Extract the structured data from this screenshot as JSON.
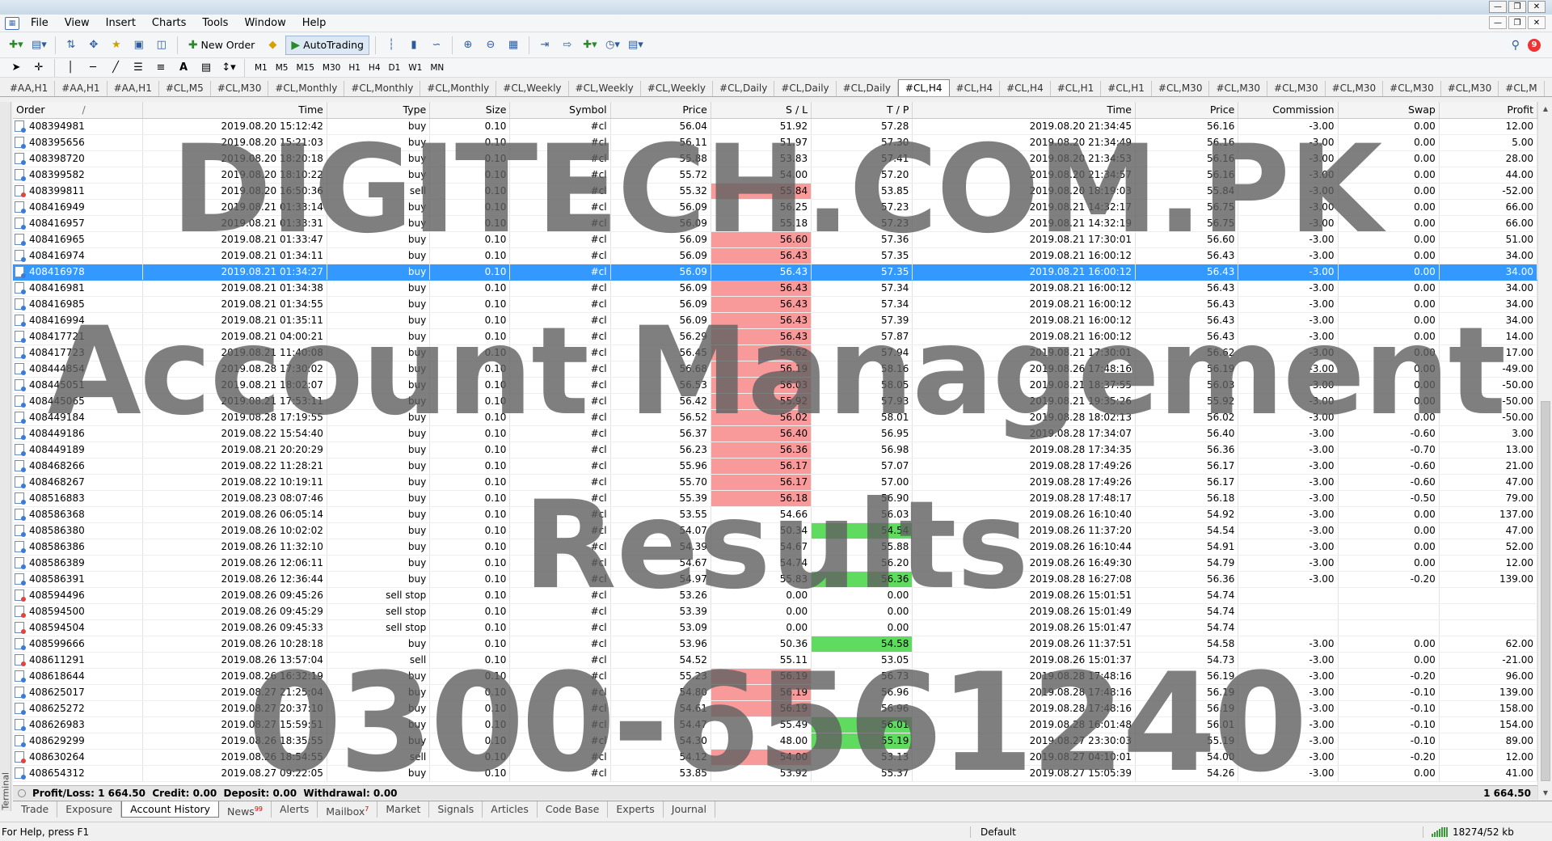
{
  "menu": [
    "File",
    "View",
    "Insert",
    "Charts",
    "Tools",
    "Window",
    "Help"
  ],
  "toolbar": {
    "new_order_label": "New Order",
    "autotrading_label": "AutoTrading",
    "timeframes": [
      "M1",
      "M5",
      "M15",
      "M30",
      "H1",
      "H4",
      "D1",
      "W1",
      "MN"
    ],
    "notification_count": "9"
  },
  "chart_tabs": [
    "#AA,H1",
    "#AA,H1",
    "#AA,H1",
    "#CL,M5",
    "#CL,M30",
    "#CL,Monthly",
    "#CL,Monthly",
    "#CL,Monthly",
    "#CL,Weekly",
    "#CL,Weekly",
    "#CL,Weekly",
    "#CL,Daily",
    "#CL,Daily",
    "#CL,Daily",
    "#CL,H4",
    "#CL,H4",
    "#CL,H4",
    "#CL,H1",
    "#CL,H1",
    "#CL,M30",
    "#CL,M30",
    "#CL,M30",
    "#CL,M30",
    "#CL,M30",
    "#CL,M30",
    "#CL,M"
  ],
  "active_chart_tab": "#CL,H4",
  "table": {
    "columns": [
      "Order",
      "Time",
      "Type",
      "Size",
      "Symbol",
      "Price",
      "S / L",
      "T / P",
      "Time",
      "Price",
      "Commission",
      "Swap",
      "Profit"
    ],
    "sort_indicator": "/",
    "rows": [
      {
        "order": "408394981",
        "t1": "2019.08.20 15:12:42",
        "type": "buy",
        "size": "0.10",
        "sym": "#cl",
        "price": "56.04",
        "sl": "51.92",
        "tp": "57.28",
        "t2": "2019.08.20 21:34:45",
        "p2": "56.16",
        "comm": "-3.00",
        "swap": "0.00",
        "profit": "12.00"
      },
      {
        "order": "408395656",
        "t1": "2019.08.20 15:21:03",
        "type": "buy",
        "size": "0.10",
        "sym": "#cl",
        "price": "56.11",
        "sl": "51.97",
        "tp": "57.30",
        "t2": "2019.08.20 21:34:49",
        "p2": "56.16",
        "comm": "-3.00",
        "swap": "0.00",
        "profit": "5.00"
      },
      {
        "order": "408398720",
        "t1": "2019.08.20 18:20:18",
        "type": "buy",
        "size": "0.10",
        "sym": "#cl",
        "price": "55.88",
        "sl": "53.83",
        "tp": "57.41",
        "t2": "2019.08.20 21:34:53",
        "p2": "56.16",
        "comm": "-3.00",
        "swap": "0.00",
        "profit": "28.00"
      },
      {
        "order": "408399582",
        "t1": "2019.08.20 18:10:22",
        "type": "buy",
        "size": "0.10",
        "sym": "#cl",
        "price": "55.72",
        "sl": "54.00",
        "tp": "57.20",
        "t2": "2019.08.20 21:34:57",
        "p2": "56.16",
        "comm": "-3.00",
        "swap": "0.00",
        "profit": "44.00"
      },
      {
        "order": "408399811",
        "t1": "2019.08.20 16:50:36",
        "type": "sell",
        "size": "0.10",
        "sym": "#cl",
        "price": "55.32",
        "sl": "55.84",
        "tp": "53.85",
        "t2": "2019.08.20 18:19:03",
        "p2": "55.84",
        "comm": "-3.00",
        "swap": "0.00",
        "profit": "-52.00",
        "slc": "red"
      },
      {
        "order": "408416949",
        "t1": "2019.08.21 01:33:14",
        "type": "buy",
        "size": "0.10",
        "sym": "#cl",
        "price": "56.09",
        "sl": "56.25",
        "tp": "57.23",
        "t2": "2019.08.21 14:32:17",
        "p2": "56.75",
        "comm": "-3.00",
        "swap": "0.00",
        "profit": "66.00"
      },
      {
        "order": "408416957",
        "t1": "2019.08.21 01:33:31",
        "type": "buy",
        "size": "0.10",
        "sym": "#cl",
        "price": "56.09",
        "sl": "55.18",
        "tp": "57.23",
        "t2": "2019.08.21 14:32:19",
        "p2": "56.75",
        "comm": "-3.00",
        "swap": "0.00",
        "profit": "66.00"
      },
      {
        "order": "408416965",
        "t1": "2019.08.21 01:33:47",
        "type": "buy",
        "size": "0.10",
        "sym": "#cl",
        "price": "56.09",
        "sl": "56.60",
        "tp": "57.36",
        "t2": "2019.08.21 17:30:01",
        "p2": "56.60",
        "comm": "-3.00",
        "swap": "0.00",
        "profit": "51.00",
        "slc": "red"
      },
      {
        "order": "408416974",
        "t1": "2019.08.21 01:34:11",
        "type": "buy",
        "size": "0.10",
        "sym": "#cl",
        "price": "56.09",
        "sl": "56.43",
        "tp": "57.35",
        "t2": "2019.08.21 16:00:12",
        "p2": "56.43",
        "comm": "-3.00",
        "swap": "0.00",
        "profit": "34.00",
        "slc": "red"
      },
      {
        "order": "408416978",
        "t1": "2019.08.21 01:34:27",
        "type": "buy",
        "size": "0.10",
        "sym": "#cl",
        "price": "56.09",
        "sl": "56.43",
        "tp": "57.35",
        "t2": "2019.08.21 16:00:12",
        "p2": "56.43",
        "comm": "-3.00",
        "swap": "0.00",
        "profit": "34.00",
        "selected": true
      },
      {
        "order": "408416981",
        "t1": "2019.08.21 01:34:38",
        "type": "buy",
        "size": "0.10",
        "sym": "#cl",
        "price": "56.09",
        "sl": "56.43",
        "tp": "57.34",
        "t2": "2019.08.21 16:00:12",
        "p2": "56.43",
        "comm": "-3.00",
        "swap": "0.00",
        "profit": "34.00",
        "slc": "red"
      },
      {
        "order": "408416985",
        "t1": "2019.08.21 01:34:55",
        "type": "buy",
        "size": "0.10",
        "sym": "#cl",
        "price": "56.09",
        "sl": "56.43",
        "tp": "57.34",
        "t2": "2019.08.21 16:00:12",
        "p2": "56.43",
        "comm": "-3.00",
        "swap": "0.00",
        "profit": "34.00",
        "slc": "red"
      },
      {
        "order": "408416994",
        "t1": "2019.08.21 01:35:11",
        "type": "buy",
        "size": "0.10",
        "sym": "#cl",
        "price": "56.09",
        "sl": "56.43",
        "tp": "57.39",
        "t2": "2019.08.21 16:00:12",
        "p2": "56.43",
        "comm": "-3.00",
        "swap": "0.00",
        "profit": "34.00",
        "slc": "red"
      },
      {
        "order": "408417721",
        "t1": "2019.08.21 04:00:21",
        "type": "buy",
        "size": "0.10",
        "sym": "#cl",
        "price": "56.29",
        "sl": "56.43",
        "tp": "57.87",
        "t2": "2019.08.21 16:00:12",
        "p2": "56.43",
        "comm": "-3.00",
        "swap": "0.00",
        "profit": "14.00",
        "slc": "red"
      },
      {
        "order": "408417723",
        "t1": "2019.08.21 11:40:08",
        "type": "buy",
        "size": "0.10",
        "sym": "#cl",
        "price": "56.45",
        "sl": "56.62",
        "tp": "57.94",
        "t2": "2019.08.21 17:30:01",
        "p2": "56.62",
        "comm": "-3.00",
        "swap": "0.00",
        "profit": "17.00",
        "slc": "red"
      },
      {
        "order": "408444854",
        "t1": "2019.08.28 17:30:02",
        "type": "buy",
        "size": "0.10",
        "sym": "#cl",
        "price": "56.68",
        "sl": "56.19",
        "tp": "58.16",
        "t2": "2019.08.26 17:48:16",
        "p2": "56.19",
        "comm": "-3.00",
        "swap": "0.00",
        "profit": "-49.00",
        "slc": "red"
      },
      {
        "order": "408445051",
        "t1": "2019.08.21 18:02:07",
        "type": "buy",
        "size": "0.10",
        "sym": "#cl",
        "price": "56.53",
        "sl": "56.03",
        "tp": "58.05",
        "t2": "2019.08.21 18:37:55",
        "p2": "56.03",
        "comm": "-3.00",
        "swap": "0.00",
        "profit": "-50.00",
        "slc": "red"
      },
      {
        "order": "408445065",
        "t1": "2019.08.21 17:53:11",
        "type": "buy",
        "size": "0.10",
        "sym": "#cl",
        "price": "56.42",
        "sl": "55.92",
        "tp": "57.93",
        "t2": "2019.08.21 19:35:26",
        "p2": "55.92",
        "comm": "-3.00",
        "swap": "0.00",
        "profit": "-50.00",
        "slc": "red"
      },
      {
        "order": "408449184",
        "t1": "2019.08.28 17:19:55",
        "type": "buy",
        "size": "0.10",
        "sym": "#cl",
        "price": "56.52",
        "sl": "56.02",
        "tp": "58.01",
        "t2": "2019.08.28 18:02:13",
        "p2": "56.02",
        "comm": "-3.00",
        "swap": "0.00",
        "profit": "-50.00",
        "slc": "red"
      },
      {
        "order": "408449186",
        "t1": "2019.08.22 15:54:40",
        "type": "buy",
        "size": "0.10",
        "sym": "#cl",
        "price": "56.37",
        "sl": "56.40",
        "tp": "56.95",
        "t2": "2019.08.28 17:34:07",
        "p2": "56.40",
        "comm": "-3.00",
        "swap": "-0.60",
        "profit": "3.00",
        "slc": "red"
      },
      {
        "order": "408449189",
        "t1": "2019.08.21 20:20:29",
        "type": "buy",
        "size": "0.10",
        "sym": "#cl",
        "price": "56.23",
        "sl": "56.36",
        "tp": "56.98",
        "t2": "2019.08.28 17:34:35",
        "p2": "56.36",
        "comm": "-3.00",
        "swap": "-0.70",
        "profit": "13.00",
        "slc": "red"
      },
      {
        "order": "408468266",
        "t1": "2019.08.22 11:28:21",
        "type": "buy",
        "size": "0.10",
        "sym": "#cl",
        "price": "55.96",
        "sl": "56.17",
        "tp": "57.07",
        "t2": "2019.08.28 17:49:26",
        "p2": "56.17",
        "comm": "-3.00",
        "swap": "-0.60",
        "profit": "21.00",
        "slc": "red"
      },
      {
        "order": "408468267",
        "t1": "2019.08.22 10:19:11",
        "type": "buy",
        "size": "0.10",
        "sym": "#cl",
        "price": "55.70",
        "sl": "56.17",
        "tp": "57.00",
        "t2": "2019.08.28 17:49:26",
        "p2": "56.17",
        "comm": "-3.00",
        "swap": "-0.60",
        "profit": "47.00",
        "slc": "red"
      },
      {
        "order": "408516883",
        "t1": "2019.08.23 08:07:46",
        "type": "buy",
        "size": "0.10",
        "sym": "#cl",
        "price": "55.39",
        "sl": "56.18",
        "tp": "56.90",
        "t2": "2019.08.28 17:48:17",
        "p2": "56.18",
        "comm": "-3.00",
        "swap": "-0.50",
        "profit": "79.00",
        "slc": "red"
      },
      {
        "order": "408586368",
        "t1": "2019.08.26 06:05:14",
        "type": "buy",
        "size": "0.10",
        "sym": "#cl",
        "price": "53.55",
        "sl": "54.66",
        "tp": "56.03",
        "t2": "2019.08.26 16:10:40",
        "p2": "54.92",
        "comm": "-3.00",
        "swap": "0.00",
        "profit": "137.00"
      },
      {
        "order": "408586380",
        "t1": "2019.08.26 10:02:02",
        "type": "buy",
        "size": "0.10",
        "sym": "#cl",
        "price": "54.07",
        "sl": "50.34",
        "tp": "54.54",
        "t2": "2019.08.26 11:37:20",
        "p2": "54.54",
        "comm": "-3.00",
        "swap": "0.00",
        "profit": "47.00",
        "tpc": "green"
      },
      {
        "order": "408586386",
        "t1": "2019.08.26 11:32:10",
        "type": "buy",
        "size": "0.10",
        "sym": "#cl",
        "price": "54.39",
        "sl": "54.67",
        "tp": "55.88",
        "t2": "2019.08.26 16:10:44",
        "p2": "54.91",
        "comm": "-3.00",
        "swap": "0.00",
        "profit": "52.00"
      },
      {
        "order": "408586389",
        "t1": "2019.08.26 12:06:11",
        "type": "buy",
        "size": "0.10",
        "sym": "#cl",
        "price": "54.67",
        "sl": "54.74",
        "tp": "56.20",
        "t2": "2019.08.26 16:49:30",
        "p2": "54.79",
        "comm": "-3.00",
        "swap": "0.00",
        "profit": "12.00"
      },
      {
        "order": "408586391",
        "t1": "2019.08.26 12:36:44",
        "type": "buy",
        "size": "0.10",
        "sym": "#cl",
        "price": "54.97",
        "sl": "55.83",
        "tp": "56.36",
        "t2": "2019.08.28 16:27:08",
        "p2": "56.36",
        "comm": "-3.00",
        "swap": "-0.20",
        "profit": "139.00",
        "tpc": "green"
      },
      {
        "order": "408594496",
        "t1": "2019.08.26 09:45:26",
        "type": "sell stop",
        "size": "0.10",
        "sym": "#cl",
        "price": "53.26",
        "sl": "0.00",
        "tp": "0.00",
        "t2": "2019.08.26 15:01:51",
        "p2": "54.74",
        "comm": "",
        "swap": "",
        "profit": ""
      },
      {
        "order": "408594500",
        "t1": "2019.08.26 09:45:29",
        "type": "sell stop",
        "size": "0.10",
        "sym": "#cl",
        "price": "53.39",
        "sl": "0.00",
        "tp": "0.00",
        "t2": "2019.08.26 15:01:49",
        "p2": "54.74",
        "comm": "",
        "swap": "",
        "profit": ""
      },
      {
        "order": "408594504",
        "t1": "2019.08.26 09:45:33",
        "type": "sell stop",
        "size": "0.10",
        "sym": "#cl",
        "price": "53.09",
        "sl": "0.00",
        "tp": "0.00",
        "t2": "2019.08.26 15:01:47",
        "p2": "54.74",
        "comm": "",
        "swap": "",
        "profit": ""
      },
      {
        "order": "408599666",
        "t1": "2019.08.26 10:28:18",
        "type": "buy",
        "size": "0.10",
        "sym": "#cl",
        "price": "53.96",
        "sl": "50.36",
        "tp": "54.58",
        "t2": "2019.08.26 11:37:51",
        "p2": "54.58",
        "comm": "-3.00",
        "swap": "0.00",
        "profit": "62.00",
        "tpc": "green"
      },
      {
        "order": "408611291",
        "t1": "2019.08.26 13:57:04",
        "type": "sell",
        "size": "0.10",
        "sym": "#cl",
        "price": "54.52",
        "sl": "55.11",
        "tp": "53.05",
        "t2": "2019.08.26 15:01:37",
        "p2": "54.73",
        "comm": "-3.00",
        "swap": "0.00",
        "profit": "-21.00"
      },
      {
        "order": "408618644",
        "t1": "2019.08.26 16:32:19",
        "type": "buy",
        "size": "0.10",
        "sym": "#cl",
        "price": "55.23",
        "sl": "56.19",
        "tp": "56.73",
        "t2": "2019.08.28 17:48:16",
        "p2": "56.19",
        "comm": "-3.00",
        "swap": "-0.20",
        "profit": "96.00",
        "slc": "red"
      },
      {
        "order": "408625017",
        "t1": "2019.08.27 21:25:04",
        "type": "buy",
        "size": "0.10",
        "sym": "#cl",
        "price": "54.80",
        "sl": "56.19",
        "tp": "56.96",
        "t2": "2019.08.28 17:48:16",
        "p2": "56.19",
        "comm": "-3.00",
        "swap": "-0.10",
        "profit": "139.00",
        "slc": "red"
      },
      {
        "order": "408625272",
        "t1": "2019.08.27 20:37:10",
        "type": "buy",
        "size": "0.10",
        "sym": "#cl",
        "price": "54.61",
        "sl": "56.19",
        "tp": "56.96",
        "t2": "2019.08.28 17:48:16",
        "p2": "56.19",
        "comm": "-3.00",
        "swap": "-0.10",
        "profit": "158.00",
        "slc": "red"
      },
      {
        "order": "408626983",
        "t1": "2019.08.27 15:59:51",
        "type": "buy",
        "size": "0.10",
        "sym": "#cl",
        "price": "54.47",
        "sl": "55.49",
        "tp": "56.01",
        "t2": "2019.08.28 16:01:48",
        "p2": "56.01",
        "comm": "-3.00",
        "swap": "-0.10",
        "profit": "154.00",
        "tpc": "green"
      },
      {
        "order": "408629299",
        "t1": "2019.08.26 18:35:55",
        "type": "buy",
        "size": "0.10",
        "sym": "#cl",
        "price": "54.30",
        "sl": "48.00",
        "tp": "55.19",
        "t2": "2019.08.27 23:30:03",
        "p2": "55.19",
        "comm": "-3.00",
        "swap": "-0.10",
        "profit": "89.00",
        "tpc": "green"
      },
      {
        "order": "408630264",
        "t1": "2019.08.26 18:54:55",
        "type": "sell",
        "size": "0.10",
        "sym": "#cl",
        "price": "54.12",
        "sl": "54.00",
        "tp": "53.13",
        "t2": "2019.08.27 04:10:01",
        "p2": "54.00",
        "comm": "-3.00",
        "swap": "-0.20",
        "profit": "12.00",
        "slc": "red"
      },
      {
        "order": "408654312",
        "t1": "2019.08.27 09:22:05",
        "type": "buy",
        "size": "0.10",
        "sym": "#cl",
        "price": "53.85",
        "sl": "53.92",
        "tp": "55.37",
        "t2": "2019.08.27 15:05:39",
        "p2": "54.26",
        "comm": "-3.00",
        "swap": "0.00",
        "profit": "41.00"
      }
    ]
  },
  "summary": {
    "text": "Profit/Loss: 1 664.50  Credit: 0.00  Deposit: 0.00  Withdrawal: 0.00",
    "total": "1 664.50"
  },
  "terminal_label": "Terminal",
  "bottom_tabs": [
    {
      "label": "Trade"
    },
    {
      "label": "Exposure"
    },
    {
      "label": "Account History",
      "active": true
    },
    {
      "label": "News",
      "badge": "99"
    },
    {
      "label": "Alerts"
    },
    {
      "label": "Mailbox",
      "badge": "7"
    },
    {
      "label": "Market"
    },
    {
      "label": "Signals"
    },
    {
      "label": "Articles"
    },
    {
      "label": "Code Base"
    },
    {
      "label": "Experts"
    },
    {
      "label": "Journal"
    }
  ],
  "status": {
    "help": "For Help, press F1",
    "profile": "Default",
    "traffic": "18274/52 kb"
  },
  "watermark": {
    "line1": "DIGITECH.COM.PK",
    "line2": "Account Management",
    "line3": "Results",
    "line4": "0300-6561240"
  }
}
